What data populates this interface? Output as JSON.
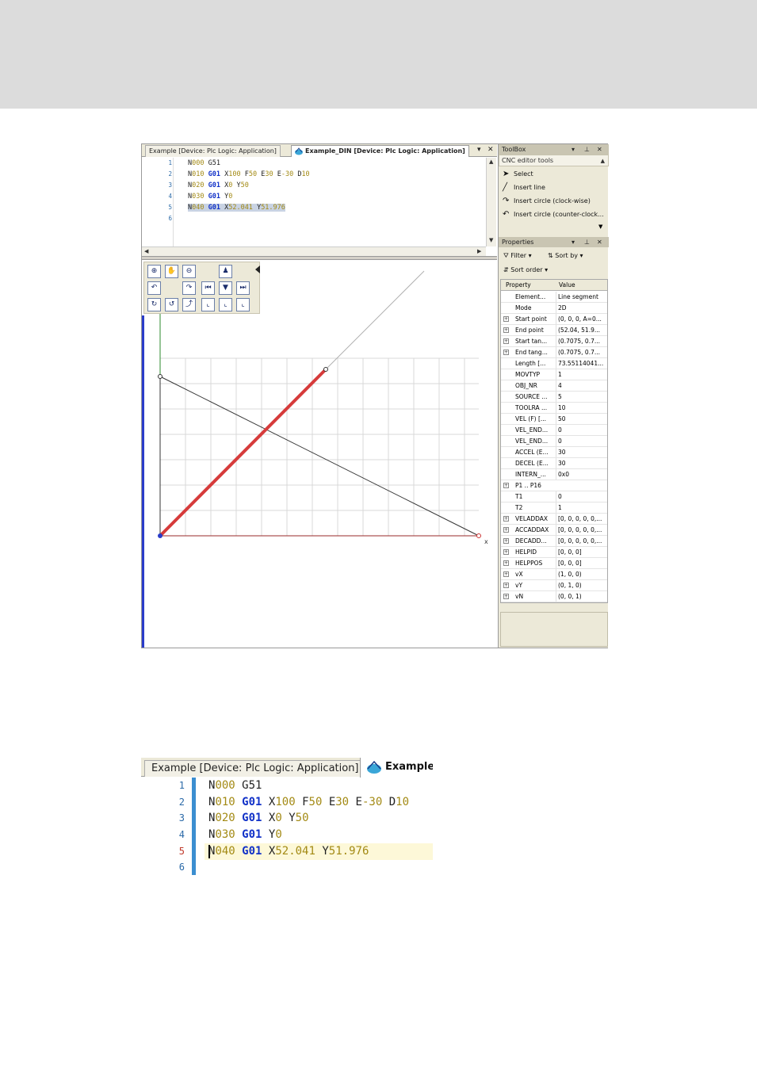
{
  "tabs": {
    "tab1": "Example [Device: Plc Logic: Application]",
    "tab2": "Example_DIN [Device: Plc Logic: Application]"
  },
  "code_lines": [
    {
      "num": "1",
      "text": "N000 G51"
    },
    {
      "num": "2",
      "text": "N010 G01 X100 F50 E30 E-30 D10"
    },
    {
      "num": "3",
      "text": "N020 G01 X0 Y50"
    },
    {
      "num": "4",
      "text": "N030 G01 Y0"
    },
    {
      "num": "5",
      "text": "N040 G01 X52.041 Y51.976"
    },
    {
      "num": "6",
      "text": ""
    }
  ],
  "canvas": {
    "x_axis_label": "x"
  },
  "toolbox": {
    "title": "ToolBox",
    "subheader": "CNC editor tools",
    "items": [
      {
        "label": "Select",
        "icon": "pointer-icon"
      },
      {
        "label": "Insert line",
        "icon": "line-icon"
      },
      {
        "label": "Insert circle (clock-wise)",
        "icon": "circle-cw-icon"
      },
      {
        "label": "Insert circle (counter-clock...",
        "icon": "circle-ccw-icon"
      }
    ]
  },
  "properties": {
    "title": "Properties",
    "filter_label": "Filter",
    "sortby_label": "Sort by",
    "sortorder_label": "Sort order",
    "col_property": "Property",
    "col_value": "Value",
    "rows": [
      {
        "prop": "Element...",
        "val": "Line segment",
        "exp": false
      },
      {
        "prop": "Mode",
        "val": "2D",
        "exp": false
      },
      {
        "prop": "Start point",
        "val": "(0, 0, 0, A=0...",
        "exp": true
      },
      {
        "prop": "End point",
        "val": "(52.04, 51.9...",
        "exp": true
      },
      {
        "prop": "Start tan...",
        "val": "(0.7075, 0.7...",
        "exp": true
      },
      {
        "prop": "End tang...",
        "val": "(0.7075, 0.7...",
        "exp": true
      },
      {
        "prop": "Length [...",
        "val": "73.55114041...",
        "exp": false
      },
      {
        "prop": "MOVTYP",
        "val": "1",
        "exp": false
      },
      {
        "prop": "OBJ_NR",
        "val": "4",
        "exp": false
      },
      {
        "prop": "SOURCE ...",
        "val": "5",
        "exp": false
      },
      {
        "prop": "TOOLRA ...",
        "val": "10",
        "exp": false
      },
      {
        "prop": "VEL (F) [...",
        "val": "50",
        "exp": false
      },
      {
        "prop": "VEL_END...",
        "val": "0",
        "exp": false
      },
      {
        "prop": "VEL_END...",
        "val": "0",
        "exp": false
      },
      {
        "prop": "ACCEL (E...",
        "val": "30",
        "exp": false
      },
      {
        "prop": "DECEL (E...",
        "val": "30",
        "exp": false
      },
      {
        "prop": "INTERN_...",
        "val": "0x0",
        "exp": false
      },
      {
        "prop": "P1 .. P16",
        "val": "",
        "exp": true
      },
      {
        "prop": "T1",
        "val": "0",
        "exp": false
      },
      {
        "prop": "T2",
        "val": "1",
        "exp": false
      },
      {
        "prop": "VELADDAX",
        "val": "[0, 0, 0, 0, 0,...",
        "exp": true
      },
      {
        "prop": "ACCADDAX",
        "val": "[0, 0, 0, 0, 0,...",
        "exp": true
      },
      {
        "prop": "DECADD...",
        "val": "[0, 0, 0, 0, 0,...",
        "exp": true
      },
      {
        "prop": "HELPID",
        "val": "[0, 0, 0]",
        "exp": true
      },
      {
        "prop": "HELPPOS",
        "val": "[0, 0, 0]",
        "exp": true
      },
      {
        "prop": "vX",
        "val": "(1, 0, 0)",
        "exp": true
      },
      {
        "prop": "vY",
        "val": "(0, 1, 0)",
        "exp": true
      },
      {
        "prop": "vN",
        "val": "(0, 0, 1)",
        "exp": true
      }
    ]
  },
  "zoom": {
    "tab1": "Example [Device: Plc Logic: Application]",
    "tab2": "Example_",
    "lines": [
      {
        "num": "1",
        "text": "N000 G51"
      },
      {
        "num": "2",
        "text": "N010 G01 X100 F50 E30 E-30 D10"
      },
      {
        "num": "3",
        "text": "N020 G01 X0 Y50"
      },
      {
        "num": "4",
        "text": "N030 G01 Y0"
      },
      {
        "num": "5",
        "text": "N040 G01 X52.041 Y51.976"
      },
      {
        "num": "6",
        "text": ""
      }
    ]
  },
  "colors": {
    "path_highlight": "#d63b3b",
    "keyword": "#1232c8",
    "number": "#a38a14",
    "accent_blue": "#2a3cc9"
  }
}
